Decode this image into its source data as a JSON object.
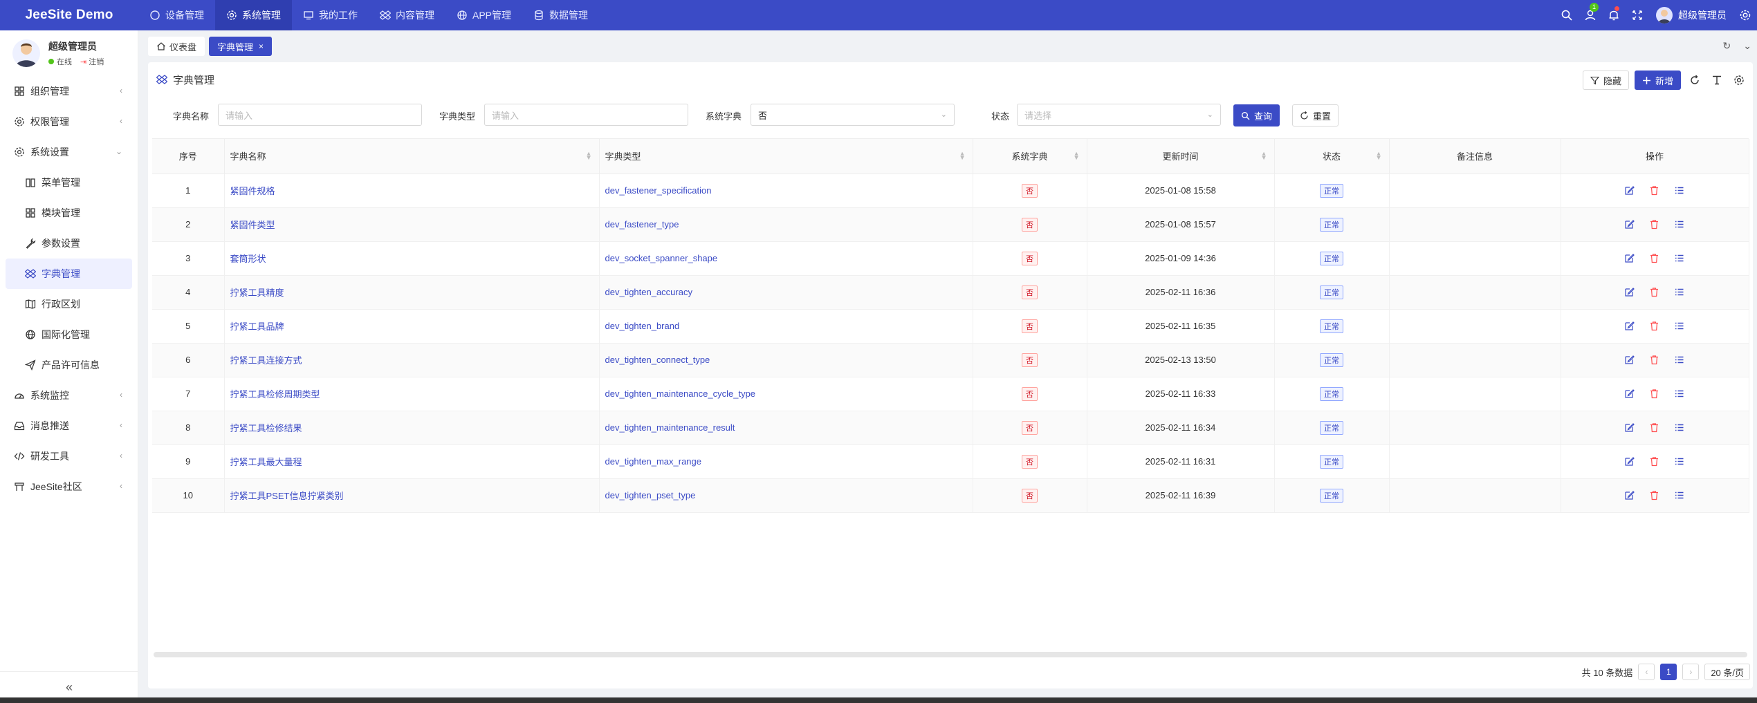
{
  "app": {
    "brand": "JeeSite Demo"
  },
  "topnav": [
    {
      "label": "设备管理",
      "icon": "circle-icon",
      "active": false
    },
    {
      "label": "系统管理",
      "icon": "gear-icon",
      "active": true
    },
    {
      "label": "我的工作",
      "icon": "monitor-icon",
      "active": false
    },
    {
      "label": "内容管理",
      "icon": "dropbox-icon",
      "active": false
    },
    {
      "label": "APP管理",
      "icon": "globe-icon",
      "active": false
    },
    {
      "label": "数据管理",
      "icon": "database-icon",
      "active": false
    }
  ],
  "topright": {
    "notif_badge": "1",
    "username": "超级管理员"
  },
  "profile": {
    "name": "超级管理员",
    "online": "在线",
    "logout": "注销"
  },
  "sidebar": {
    "items": [
      {
        "label": "组织管理",
        "icon": "grid-icon",
        "level": 1,
        "arrow": "‹"
      },
      {
        "label": "权限管理",
        "icon": "gear-icon",
        "level": 1,
        "arrow": "‹"
      },
      {
        "label": "系统设置",
        "icon": "gear-icon",
        "level": 1,
        "arrow": "⌄"
      },
      {
        "label": "菜单管理",
        "icon": "book-icon",
        "level": 2
      },
      {
        "label": "模块管理",
        "icon": "grid-icon",
        "level": 2
      },
      {
        "label": "参数设置",
        "icon": "wrench-icon",
        "level": 2
      },
      {
        "label": "字典管理",
        "icon": "dropbox-icon",
        "level": 2,
        "active": true
      },
      {
        "label": "行政区划",
        "icon": "map-icon",
        "level": 2
      },
      {
        "label": "国际化管理",
        "icon": "globe-icon",
        "level": 2
      },
      {
        "label": "产品许可信息",
        "icon": "send-icon",
        "level": 2
      },
      {
        "label": "系统监控",
        "icon": "dashboard-icon",
        "level": 1,
        "arrow": "‹"
      },
      {
        "label": "消息推送",
        "icon": "inbox-icon",
        "level": 1,
        "arrow": "‹"
      },
      {
        "label": "研发工具",
        "icon": "code-icon",
        "level": 1,
        "arrow": "‹"
      },
      {
        "label": "JeeSite社区",
        "icon": "book-icon",
        "level": 1,
        "arrow": "‹"
      }
    ],
    "collapse": "«"
  },
  "tabs": [
    {
      "label": "仪表盘",
      "icon": "home-icon",
      "active": false
    },
    {
      "label": "字典管理",
      "active": true,
      "close": "×"
    }
  ],
  "page": {
    "title": "字典管理"
  },
  "toolbar": {
    "hide": "隐藏",
    "add": "新增"
  },
  "search": {
    "name_label": "字典名称",
    "name_placeholder": "请输入",
    "type_label": "字典类型",
    "type_placeholder": "请输入",
    "sys_label": "系统字典",
    "sys_value": "否",
    "status_label": "状态",
    "status_placeholder": "请选择",
    "query": "查询",
    "reset": "重置"
  },
  "table": {
    "columns": [
      "序号",
      "字典名称",
      "字典类型",
      "系统字典",
      "更新时间",
      "状态",
      "备注信息",
      "操作"
    ],
    "rows": [
      {
        "no": "1",
        "name": "紧固件规格",
        "type": "dev_fastener_specification",
        "sys": "否",
        "time": "2025-01-08 15:58",
        "status": "正常",
        "remark": ""
      },
      {
        "no": "2",
        "name": "紧固件类型",
        "type": "dev_fastener_type",
        "sys": "否",
        "time": "2025-01-08 15:57",
        "status": "正常",
        "remark": ""
      },
      {
        "no": "3",
        "name": "套筒形状",
        "type": "dev_socket_spanner_shape",
        "sys": "否",
        "time": "2025-01-09 14:36",
        "status": "正常",
        "remark": ""
      },
      {
        "no": "4",
        "name": "拧紧工具精度",
        "type": "dev_tighten_accuracy",
        "sys": "否",
        "time": "2025-02-11 16:36",
        "status": "正常",
        "remark": ""
      },
      {
        "no": "5",
        "name": "拧紧工具品牌",
        "type": "dev_tighten_brand",
        "sys": "否",
        "time": "2025-02-11 16:35",
        "status": "正常",
        "remark": ""
      },
      {
        "no": "6",
        "name": "拧紧工具连接方式",
        "type": "dev_tighten_connect_type",
        "sys": "否",
        "time": "2025-02-13 13:50",
        "status": "正常",
        "remark": ""
      },
      {
        "no": "7",
        "name": "拧紧工具检修周期类型",
        "type": "dev_tighten_maintenance_cycle_type",
        "sys": "否",
        "time": "2025-02-11 16:33",
        "status": "正常",
        "remark": ""
      },
      {
        "no": "8",
        "name": "拧紧工具检修结果",
        "type": "dev_tighten_maintenance_result",
        "sys": "否",
        "time": "2025-02-11 16:34",
        "status": "正常",
        "remark": ""
      },
      {
        "no": "9",
        "name": "拧紧工具最大量程",
        "type": "dev_tighten_max_range",
        "sys": "否",
        "time": "2025-02-11 16:31",
        "status": "正常",
        "remark": ""
      },
      {
        "no": "10",
        "name": "拧紧工具PSET信息拧紧类别",
        "type": "dev_tighten_pset_type",
        "sys": "否",
        "time": "2025-02-11 16:39",
        "status": "正常",
        "remark": ""
      }
    ]
  },
  "pager": {
    "total": "共 10 条数据",
    "prev": "‹",
    "current": "1",
    "next": "›",
    "size": "20 条/页"
  },
  "colors": {
    "primary": "#3b4bc6",
    "danger": "#ff4d4f",
    "success": "#52c41a"
  }
}
